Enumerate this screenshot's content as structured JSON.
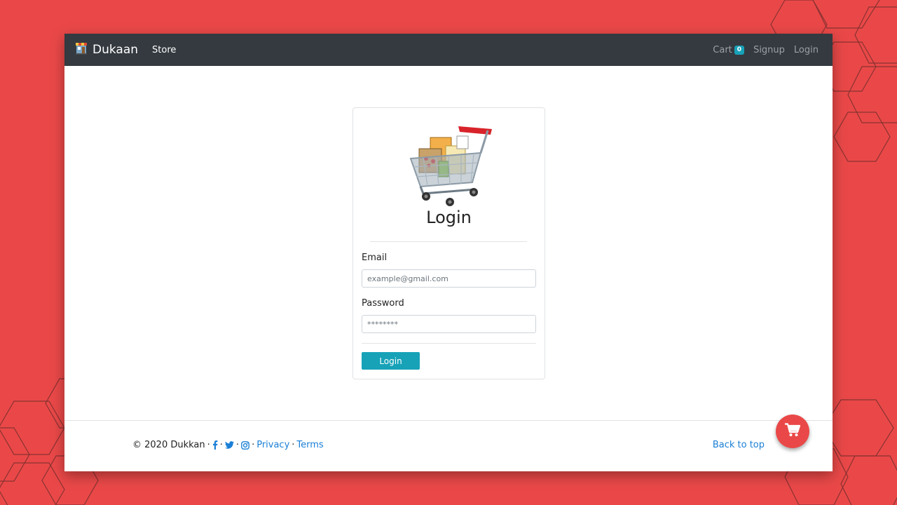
{
  "navbar": {
    "brand": "Dukaan",
    "store_label": "Store",
    "cart_label": "Cart",
    "cart_count": "0",
    "signup_label": "Signup",
    "login_label": "Login"
  },
  "login_card": {
    "title": "Login",
    "email_label": "Email",
    "email_placeholder": "example@gmail.com",
    "email_value": "",
    "password_label": "Password",
    "password_placeholder": "********",
    "submit_label": "Login"
  },
  "footer": {
    "copyright": "© 2020 Dukkan",
    "separator": "·",
    "privacy_label": "Privacy",
    "terms_label": "Terms",
    "back_to_top_label": "Back to top"
  },
  "icons": {
    "brand": "shop-icon",
    "card_image": "shopping-cart-image",
    "social": [
      "facebook-icon",
      "twitter-icon",
      "instagram-icon"
    ],
    "fab": "cart-icon"
  },
  "colors": {
    "background": "#ea4848",
    "navbar": "#343a40",
    "accent": "#17a2b8",
    "link": "#1a7fd6",
    "fab": "#ea4848"
  }
}
